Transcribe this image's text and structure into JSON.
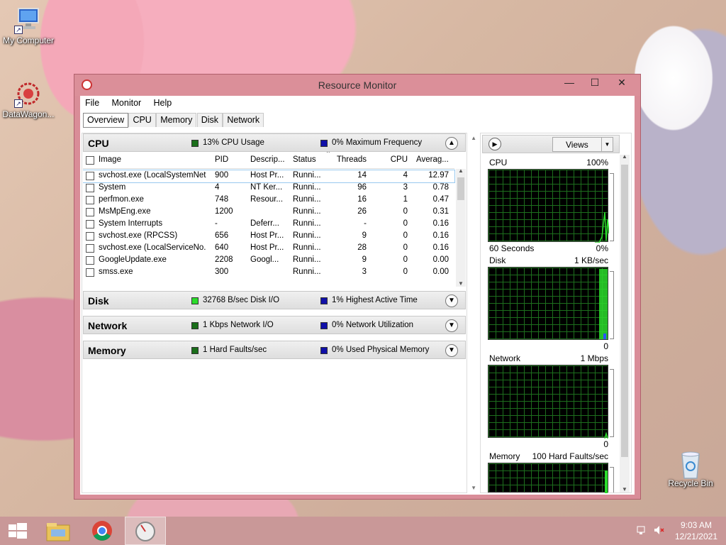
{
  "desktop": {
    "icons": [
      {
        "label": "My Computer"
      },
      {
        "label": "DataWagon..."
      },
      {
        "label": "Recycle Bin"
      }
    ]
  },
  "window": {
    "title": "Resource Monitor",
    "controls": {
      "minimize": "—",
      "maximize": "☐",
      "close": "✕"
    }
  },
  "menu": [
    "File",
    "Monitor",
    "Help"
  ],
  "tabs": [
    "Overview",
    "CPU",
    "Memory",
    "Disk",
    "Network"
  ],
  "active_tab": "Overview",
  "cpu": {
    "title": "CPU",
    "stat1": "13% CPU Usage",
    "stat2": "0% Maximum Frequency",
    "columns": [
      "Image",
      "PID",
      "Descrip...",
      "Status",
      "Threads",
      "CPU",
      "Averag..."
    ],
    "rows": [
      {
        "image": "svchost.exe (LocalSystemNet...",
        "pid": "900",
        "desc": "Host Pr...",
        "status": "Runni...",
        "threads": "14",
        "cpu": "4",
        "avg": "12.97"
      },
      {
        "image": "System",
        "pid": "4",
        "desc": "NT Ker...",
        "status": "Runni...",
        "threads": "96",
        "cpu": "3",
        "avg": "0.78"
      },
      {
        "image": "perfmon.exe",
        "pid": "748",
        "desc": "Resour...",
        "status": "Runni...",
        "threads": "16",
        "cpu": "1",
        "avg": "0.47"
      },
      {
        "image": "MsMpEng.exe",
        "pid": "1200",
        "desc": "",
        "status": "Runni...",
        "threads": "26",
        "cpu": "0",
        "avg": "0.31"
      },
      {
        "image": "System Interrupts",
        "pid": "-",
        "desc": "Deferr...",
        "status": "Runni...",
        "threads": "-",
        "cpu": "0",
        "avg": "0.16"
      },
      {
        "image": "svchost.exe (RPCSS)",
        "pid": "656",
        "desc": "Host Pr...",
        "status": "Runni...",
        "threads": "9",
        "cpu": "0",
        "avg": "0.16"
      },
      {
        "image": "svchost.exe (LocalServiceNo...",
        "pid": "640",
        "desc": "Host Pr...",
        "status": "Runni...",
        "threads": "28",
        "cpu": "0",
        "avg": "0.16"
      },
      {
        "image": "GoogleUpdate.exe",
        "pid": "2208",
        "desc": "Googl...",
        "status": "Runni...",
        "threads": "9",
        "cpu": "0",
        "avg": "0.00"
      },
      {
        "image": "smss.exe",
        "pid": "300",
        "desc": "",
        "status": "Runni...",
        "threads": "3",
        "cpu": "0",
        "avg": "0.00"
      }
    ]
  },
  "disk": {
    "title": "Disk",
    "stat1": "32768 B/sec Disk I/O",
    "stat2": "1% Highest Active Time"
  },
  "network": {
    "title": "Network",
    "stat1": "1 Kbps Network I/O",
    "stat2": "0% Network Utilization"
  },
  "memory": {
    "title": "Memory",
    "stat1": "1 Hard Faults/sec",
    "stat2": "0% Used Physical Memory"
  },
  "right_pane": {
    "views_label": "Views",
    "graphs": [
      {
        "name": "CPU",
        "max": "100%",
        "footer_left": "60 Seconds",
        "footer_right": "0%"
      },
      {
        "name": "Disk",
        "max": "1 KB/sec",
        "footer_left": "",
        "footer_right": "0"
      },
      {
        "name": "Network",
        "max": "1 Mbps",
        "footer_left": "",
        "footer_right": "0"
      },
      {
        "name": "Memory",
        "max": "100 Hard Faults/sec",
        "footer_left": "",
        "footer_right": ""
      }
    ]
  },
  "taskbar": {
    "time": "9:03 AM",
    "date": "12/21/2021"
  }
}
